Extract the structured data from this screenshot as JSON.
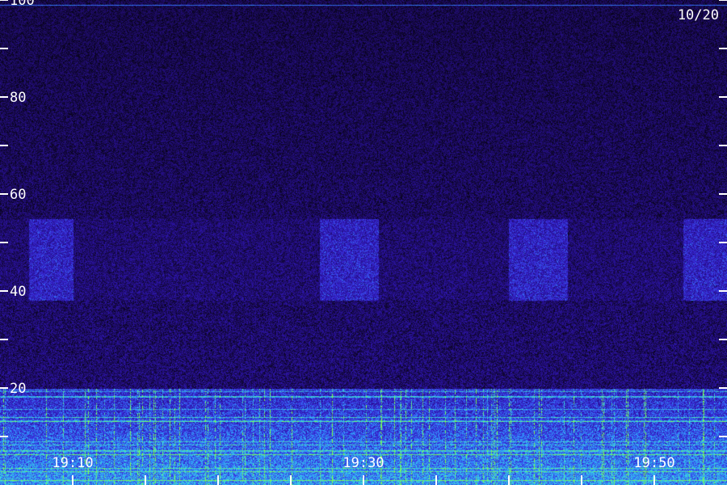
{
  "chart_data": {
    "type": "heatmap",
    "title": "",
    "date_label": "10/20",
    "xlabel": "",
    "ylabel": "",
    "x_tick_labels": [
      "19:10",
      "19:30",
      "19:50"
    ],
    "x_ticks_every_min": 5,
    "x_range": [
      "19:05",
      "19:55"
    ],
    "y_tick_labels": [
      "20",
      "40",
      "60",
      "80",
      "100"
    ],
    "y_ticks_every": 10,
    "y_range": [
      0,
      100
    ],
    "colormap": [
      "#000000",
      "#1a0a55",
      "#2a12a0",
      "#3a30e0",
      "#2f9cff",
      "#40e0d0",
      "#7dff4a"
    ],
    "features": {
      "low_band_noise": [
        0,
        20
      ],
      "pulse_band": [
        38,
        55
      ],
      "pulse_windows": [
        [
          "19:07",
          "19:10"
        ],
        [
          "19:27",
          "19:31"
        ],
        [
          "19:40",
          "19:44"
        ],
        [
          "19:52",
          "19:55"
        ]
      ],
      "steady_line_y": 99
    }
  }
}
